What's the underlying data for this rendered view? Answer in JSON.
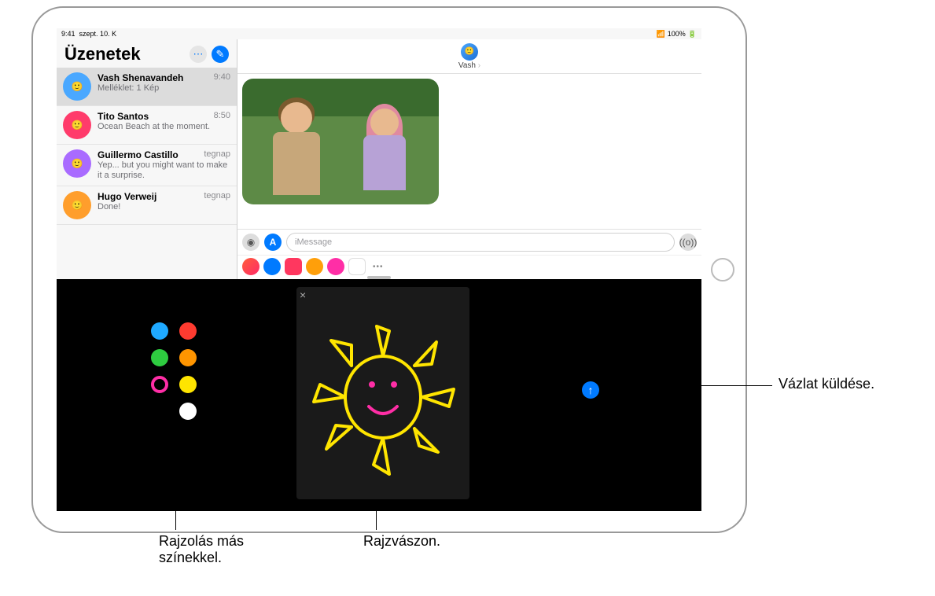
{
  "statusbar": {
    "time": "9:41",
    "date": "szept. 10. K",
    "battery": "100%"
  },
  "sidebar": {
    "title": "Üzenetek",
    "conversations": [
      {
        "name": "Vash Shenavandeh",
        "time": "9:40",
        "preview": "Melléklet: 1 Kép",
        "avatar_color": "#4aa8ff"
      },
      {
        "name": "Tito Santos",
        "time": "8:50",
        "preview": "Ocean Beach at the moment.",
        "avatar_color": "#ff3b6b"
      },
      {
        "name": "Guillermo Castillo",
        "time": "tegnap",
        "preview": "Yep... but you might want to make it a surprise.",
        "avatar_color": "#a96bff"
      },
      {
        "name": "Hugo Verweij",
        "time": "tegnap",
        "preview": "Done!",
        "avatar_color": "#ff9e2c"
      }
    ]
  },
  "main": {
    "contact_name": "Vash"
  },
  "input": {
    "placeholder": "iMessage"
  },
  "palette": {
    "left": [
      "#1fa9ff",
      "#2ecc40",
      "#ff2ea6"
    ],
    "right": [
      "#ff3b30",
      "#ff9500",
      "#ffe500",
      "#ffffff"
    ],
    "selected": "#ff2ea6"
  },
  "canvas": {
    "close": "×"
  },
  "send": {
    "glyph": "↑"
  },
  "callouts": {
    "send": "Vázlat küldése.",
    "colors_line1": "Rajzolás más",
    "colors_line2": "színekkel.",
    "canvas": "Rajzvászon."
  },
  "icons": {
    "more": "⋯",
    "compose": "✎",
    "camera": "📷",
    "appstore": "A",
    "voice": "●"
  },
  "drawer_colors": [
    "#ffcc00",
    "#007aff",
    "#ff375f",
    "#ff9f0a",
    "#ff2ea6",
    "#30b0c7"
  ]
}
